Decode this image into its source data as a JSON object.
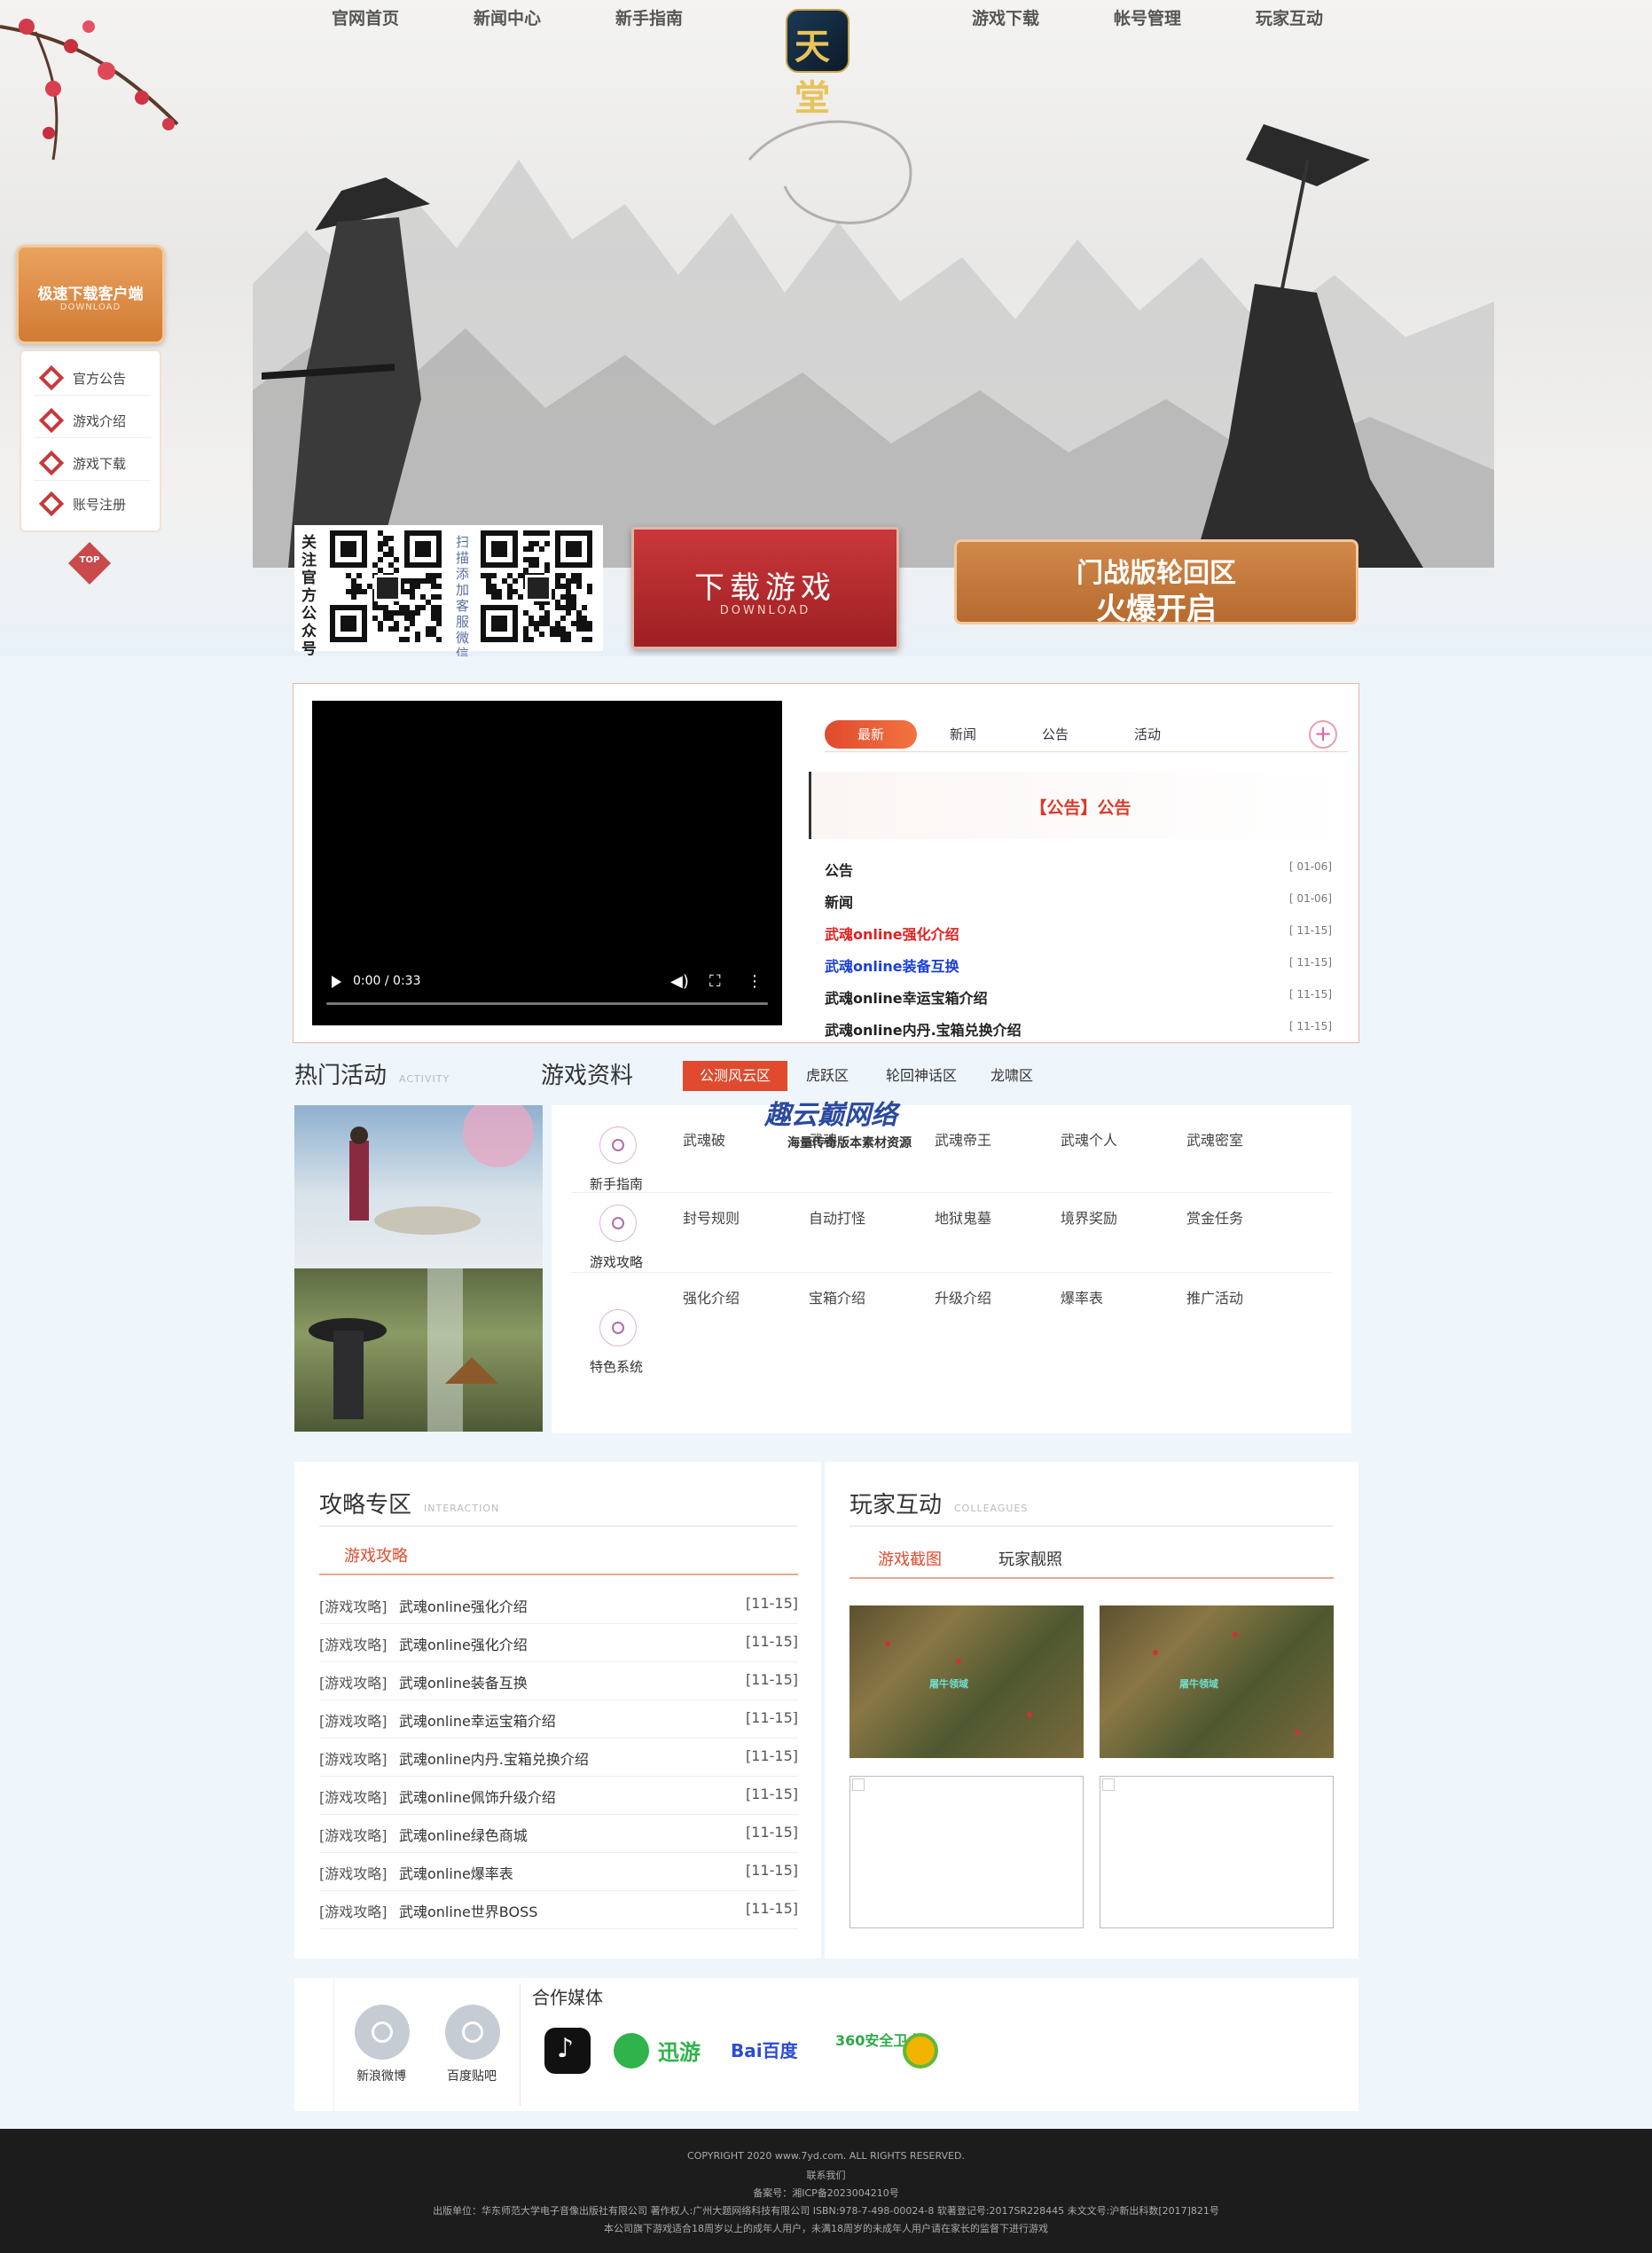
{
  "nav": {
    "items": [
      "官网首页",
      "新闻中心",
      "新手指南",
      "游戏下载",
      "帐号管理",
      "玩家互动"
    ],
    "logo_text": "天堂"
  },
  "side": {
    "download_title": "极速下载客户端",
    "download_sub": "DOWNLOAD",
    "items": [
      "官方公告",
      "游戏介绍",
      "游戏下载",
      "账号注册"
    ],
    "top_label": "TOP"
  },
  "hero": {
    "qr_follow": "关注官方公众号",
    "qr_scan": "扫描添加客服微信",
    "download_button": "下载游戏",
    "download_button_sub": "DOWNLOAD",
    "promo_line1": "门战版轮回区",
    "promo_line2": "火爆开启"
  },
  "video": {
    "time": "0:00 / 0:33"
  },
  "news": {
    "tabs": [
      "最新",
      "新闻",
      "公告",
      "活动"
    ],
    "active_tab": "最新",
    "plus": "+",
    "headline": "【公告】公告",
    "rows": [
      {
        "title": "公告",
        "date": "[ 01-06]",
        "color": "#222222"
      },
      {
        "title": "新闻",
        "date": "[ 01-06]",
        "color": "#222222"
      },
      {
        "title": "武魂online强化介绍",
        "date": "[ 11-15]",
        "color": "#e02020"
      },
      {
        "title": "武魂online装备互换",
        "date": "[ 11-15]",
        "color": "#1a3fd6"
      },
      {
        "title": "武魂online幸运宝箱介绍",
        "date": "[ 11-15]",
        "color": "#222222"
      },
      {
        "title": "武魂online内丹.宝箱兑换介绍",
        "date": "[ 11-15]",
        "color": "#222222"
      }
    ]
  },
  "activity": {
    "title": "热门活动",
    "subtitle": "ACTIVITY"
  },
  "gamedata": {
    "title": "游戏资料",
    "tabs": [
      "公测风云区",
      "虎跃区",
      "轮回神话区",
      "龙啸区"
    ],
    "active_tab": "公测风云区",
    "categories": [
      {
        "label": "新手指南",
        "items": [
          "武魂破",
          "武魂",
          "武魂帝王",
          "武魂个人",
          "武魂密室"
        ]
      },
      {
        "label": "游戏攻略",
        "items": [
          "封号规则",
          "自动打怪",
          "地狱鬼墓",
          "境界奖励",
          "赏金任务"
        ]
      },
      {
        "label": "特色系统",
        "items": [
          "强化介绍",
          "宝箱介绍",
          "升级介绍",
          "爆率表",
          "推广活动"
        ]
      }
    ],
    "watermark_title": "趣云巅网络",
    "watermark_sub": "海量传奇版本素材资源"
  },
  "strategy": {
    "title": "攻略专区",
    "subtitle": "INTERACTION",
    "tab": "游戏攻略",
    "rows": [
      {
        "cat": "[游戏攻略]",
        "title": "武魂online强化介绍",
        "date": "[11-15]"
      },
      {
        "cat": "[游戏攻略]",
        "title": "武魂online强化介绍",
        "date": "[11-15]"
      },
      {
        "cat": "[游戏攻略]",
        "title": "武魂online装备互换",
        "date": "[11-15]"
      },
      {
        "cat": "[游戏攻略]",
        "title": "武魂online幸运宝箱介绍",
        "date": "[11-15]"
      },
      {
        "cat": "[游戏攻略]",
        "title": "武魂online内丹.宝箱兑换介绍",
        "date": "[11-15]"
      },
      {
        "cat": "[游戏攻略]",
        "title": "武魂online佩饰升级介绍",
        "date": "[11-15]"
      },
      {
        "cat": "[游戏攻略]",
        "title": "武魂online绿色商城",
        "date": "[11-15]"
      },
      {
        "cat": "[游戏攻略]",
        "title": "武魂online爆率表",
        "date": "[11-15]"
      },
      {
        "cat": "[游戏攻略]",
        "title": "武魂online世界BOSS",
        "date": "[11-15]"
      }
    ]
  },
  "interaction": {
    "title": "玩家互动",
    "subtitle": "COLLEAGUES",
    "tabs": [
      "游戏截图",
      "玩家靓照"
    ],
    "active_tab": "游戏截图",
    "shot_label": "屠牛领域"
  },
  "media": {
    "social": [
      "新浪微博",
      "百度贴吧"
    ],
    "title": "合作媒体",
    "partners": [
      "迅游",
      "Bai百度",
      "360安全卫士"
    ]
  },
  "footer": {
    "copyright": "COPYRIGHT 2020 www.7yd.com. ALL RIGHTS RESERVED.",
    "contact": "联系我们",
    "icp": "备案号：湘ICP备2023004210号",
    "publisher": "出版单位：华东师范大学电子音像出版社有限公司  著作权人:广州大题网络科技有限公司  ISBN:978-7-498-00024-8  软著登记号:2017SR228445  未文文号:沪新出科数[2017]821号",
    "notice": "本公司旗下游戏适合18周岁以上的成年人用户，未满18周岁的未成年人用户请在家长的监督下进行游戏"
  },
  "colors": {
    "accent": "#e04a2e",
    "download_red": "#b82a2d",
    "promo_orange": "#c97a3b"
  }
}
